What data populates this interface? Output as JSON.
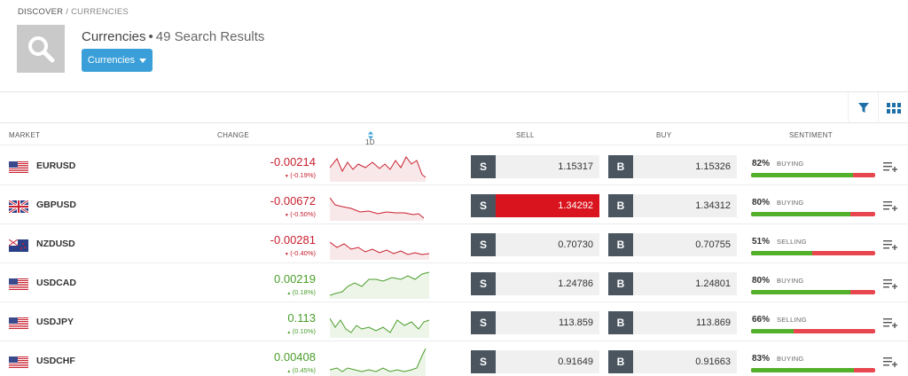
{
  "breadcrumb": {
    "root": "DISCOVER",
    "separator": "/",
    "current": "CURRENCIES"
  },
  "header": {
    "title": "Currencies",
    "bullet": "•",
    "results": "49 Search Results",
    "dropdown_label": "Currencies"
  },
  "colors": {
    "accent": "#3a9fd8",
    "negative": "#c8202e",
    "positive": "#4a9e2a",
    "sell_active": "#d9141e",
    "sentiment_buy": "#53b02a",
    "sentiment_sell": "#e8464f"
  },
  "columns": {
    "market": "MARKET",
    "change": "CHANGE",
    "period": "1D",
    "sell": "SELL",
    "buy": "BUY",
    "sentiment": "SENTIMENT"
  },
  "buttons": {
    "sell": "S",
    "buy": "B"
  },
  "rows": [
    {
      "symbol": "EURUSD",
      "flag": "us-flag",
      "change": "-0.00214",
      "change_pct": "(-0.19%)",
      "direction": "down",
      "sell": "1.15317",
      "buy": "1.15326",
      "sell_active": false,
      "sentiment_pct": "82%",
      "sentiment_label": "BUYING",
      "sentiment_value": 82
    },
    {
      "symbol": "GBPUSD",
      "flag": "uk-flag",
      "change": "-0.00672",
      "change_pct": "(-0.50%)",
      "direction": "down",
      "sell": "1.34292",
      "buy": "1.34312",
      "sell_active": true,
      "sentiment_pct": "80%",
      "sentiment_label": "BUYING",
      "sentiment_value": 80
    },
    {
      "symbol": "NZDUSD",
      "flag": "nz-flag",
      "change": "-0.00281",
      "change_pct": "(-0.40%)",
      "direction": "down",
      "sell": "0.70730",
      "buy": "0.70755",
      "sell_active": false,
      "sentiment_pct": "51%",
      "sentiment_label": "SELLING",
      "sentiment_value": 49
    },
    {
      "symbol": "USDCAD",
      "flag": "us-flag",
      "change": "0.00219",
      "change_pct": "(0.18%)",
      "direction": "up",
      "sell": "1.24786",
      "buy": "1.24801",
      "sell_active": false,
      "sentiment_pct": "80%",
      "sentiment_label": "BUYING",
      "sentiment_value": 80
    },
    {
      "symbol": "USDJPY",
      "flag": "us-flag",
      "change": "0.113",
      "change_pct": "(0.10%)",
      "direction": "up",
      "sell": "113.859",
      "buy": "113.869",
      "sell_active": false,
      "sentiment_pct": "66%",
      "sentiment_label": "SELLING",
      "sentiment_value": 34
    },
    {
      "symbol": "USDCHF",
      "flag": "us-flag",
      "change": "0.00408",
      "change_pct": "(0.45%)",
      "direction": "up",
      "sell": "0.91649",
      "buy": "0.91663",
      "sell_active": false,
      "sentiment_pct": "83%",
      "sentiment_label": "BUYING",
      "sentiment_value": 83
    }
  ]
}
